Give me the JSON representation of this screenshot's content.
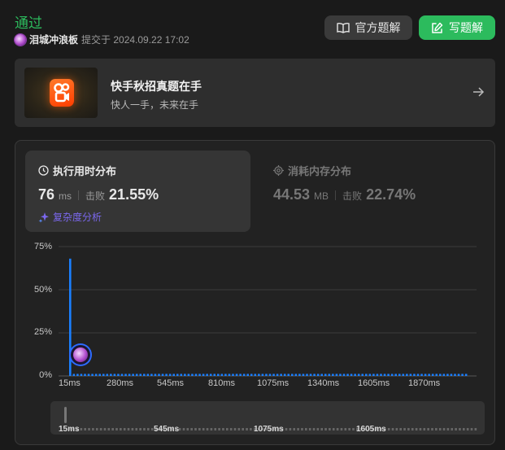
{
  "header": {
    "status": "通过",
    "author": "泪城冲浪板",
    "submitted": "提交于 2024.09.22 17:02",
    "official_solution_label": "官方题解",
    "write_solution_label": "写题解"
  },
  "banner": {
    "title": "快手秋招真题在手",
    "subtitle": "快人一手，未来在手"
  },
  "runtime": {
    "title": "执行用时分布",
    "value": "76",
    "unit": "ms",
    "beat_label": "击败",
    "beat_pct": "21.55%",
    "complexity_label": "复杂度分析"
  },
  "memory": {
    "title": "消耗内存分布",
    "value": "44.53",
    "unit": "MB",
    "beat_label": "击败",
    "beat_pct": "22.74%"
  },
  "chart_data": {
    "type": "bar",
    "y_ticks": [
      "75%",
      "50%",
      "25%",
      "0%"
    ],
    "ylim": [
      0,
      75
    ],
    "x_ticks": [
      "15ms",
      "280ms",
      "545ms",
      "810ms",
      "1075ms",
      "1340ms",
      "1605ms",
      "1870ms"
    ],
    "series": [
      {
        "values": [
          68,
          1.2,
          1.2,
          1.2,
          1.2,
          1.2,
          1.2,
          1.2,
          1.2,
          1.2,
          1.2,
          1.2,
          1.2,
          1.2,
          1.2,
          1.2,
          1.2,
          1.2,
          1.2,
          1.2,
          1.2,
          1.2,
          1.2,
          1.2,
          1.2,
          1.2,
          1.2,
          1.2,
          1.2,
          1.2,
          1.2,
          1.2,
          1.2,
          1.2,
          1.2,
          1.2,
          1.2,
          1.2,
          1.2,
          1.2,
          1.2,
          1.2,
          1.2,
          1.2,
          1.2,
          1.2,
          1.2,
          1.2,
          1.2,
          1.2,
          1.2,
          1.2,
          1.2,
          1.2,
          1.2,
          1.2,
          1.2,
          1.2,
          1.2,
          1.2,
          1.2,
          1.2,
          1.2,
          1.2,
          1.2,
          1.2,
          1.2,
          1.2,
          1.2,
          1.2,
          1.2,
          1.2,
          1.2,
          1.2,
          1.2,
          1.2,
          1.2,
          1.2,
          1.2,
          1.2,
          1.2,
          1.2,
          1.2,
          1.2,
          1.2,
          1.2,
          1.2,
          1.2,
          1.2,
          1.2,
          1.2,
          1.2,
          1.2,
          1.2,
          1.2,
          1.2,
          1.2,
          1.2,
          1.2,
          1.2,
          1.2,
          1.2,
          1.2,
          1.2,
          1.2,
          1.2,
          1.2,
          1.2
        ]
      }
    ],
    "bar_color": "#1a7fff",
    "grid": true,
    "minimap_ticks": [
      "15ms",
      "545ms",
      "1075ms",
      "1605ms"
    ]
  },
  "colors": {
    "accent_green": "#2cbb5d",
    "bar_blue": "#1a7fff",
    "complexity_purple": "#7b68ee"
  }
}
